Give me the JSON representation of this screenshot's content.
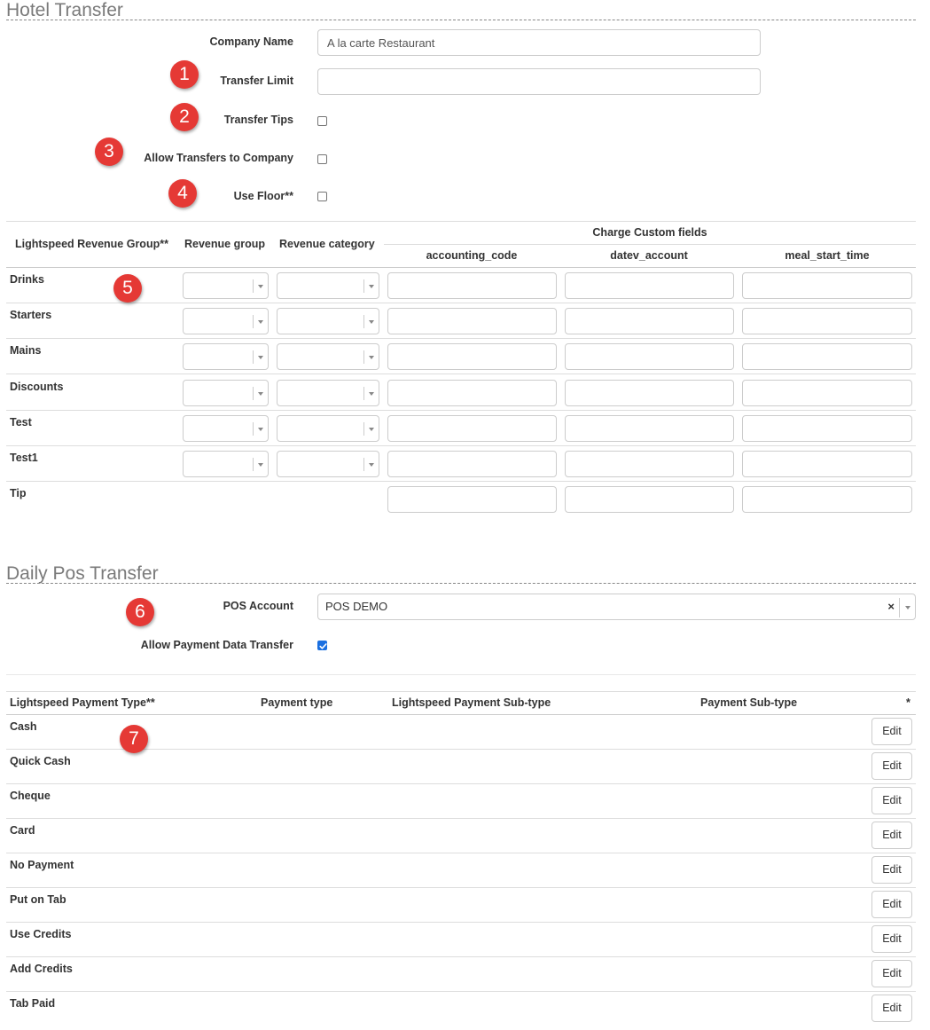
{
  "hotel": {
    "title": "Hotel Transfer",
    "company_name_label": "Company Name",
    "company_name_value": "A la carte Restaurant",
    "transfer_limit_label": "Transfer Limit",
    "transfer_limit_value": "",
    "transfer_tips_label": "Transfer Tips",
    "transfer_tips_checked": false,
    "allow_transfers_label": "Allow Transfers to Company",
    "allow_transfers_checked": false,
    "use_floor_label": "Use Floor**",
    "use_floor_checked": false
  },
  "revenue_table": {
    "headers": {
      "group": "Lightspeed Revenue Group**",
      "revenue_group": "Revenue group",
      "revenue_category": "Revenue category",
      "charge_custom": "Charge Custom fields",
      "accounting_code": "accounting_code",
      "datev_account": "datev_account",
      "meal_start_time": "meal_start_time"
    },
    "rows": [
      {
        "label": "Drinks",
        "has_selects": true
      },
      {
        "label": "Starters",
        "has_selects": true
      },
      {
        "label": "Mains",
        "has_selects": true
      },
      {
        "label": "Discounts",
        "has_selects": true
      },
      {
        "label": "Test",
        "has_selects": true
      },
      {
        "label": "Test1",
        "has_selects": true
      },
      {
        "label": "Tip",
        "has_selects": false
      }
    ]
  },
  "pos": {
    "title": "Daily Pos Transfer",
    "account_label": "POS Account",
    "account_value": "POS DEMO",
    "clear_symbol": "×",
    "allow_payment_label": "Allow Payment Data Transfer",
    "allow_payment_checked": true
  },
  "payment_table": {
    "headers": {
      "type": "Lightspeed Payment Type**",
      "payment_type": "Payment type",
      "sub_type": "Lightspeed Payment Sub-type",
      "payment_sub_type": "Payment Sub-type",
      "star": "*"
    },
    "edit_label": "Edit",
    "rows": [
      "Cash",
      "Quick Cash",
      "Cheque",
      "Card",
      "No Payment",
      "Put on Tab",
      "Use Credits",
      "Add Credits",
      "Tab Paid"
    ]
  },
  "badges": [
    "1",
    "2",
    "3",
    "4",
    "5",
    "6",
    "7"
  ],
  "colors": {
    "badge": "#e53935",
    "checkbox_checked": "#1a6fe0",
    "border": "#cccccc"
  },
  "icons": {
    "select_arrow": "chevron-down-icon",
    "clear": "close-icon",
    "check": "check-icon"
  }
}
